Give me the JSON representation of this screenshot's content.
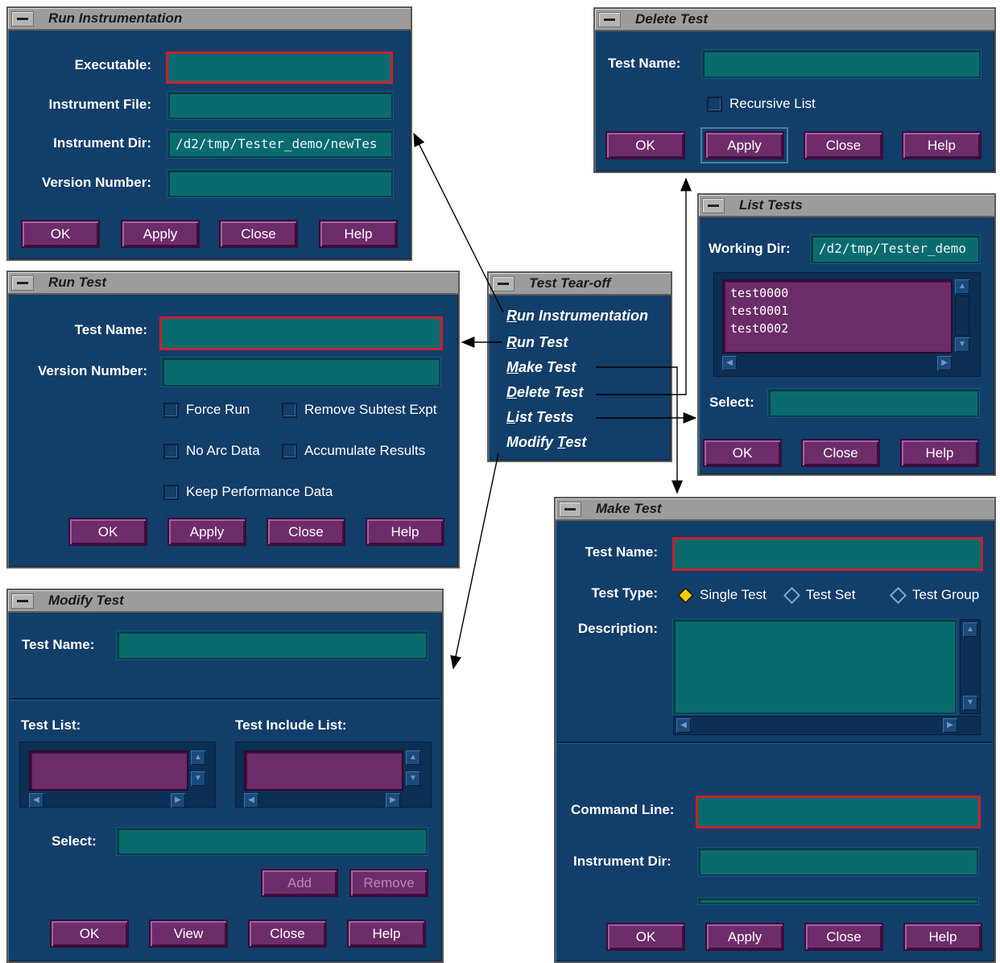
{
  "common": {
    "ok": "OK",
    "apply": "Apply",
    "close": "Close",
    "help": "Help",
    "view": "View",
    "add": "Add",
    "remove": "Remove"
  },
  "run_instrumentation": {
    "title": "Run Instrumentation",
    "executable_label": "Executable:",
    "executable_value": "",
    "instrument_file_label": "Instrument File:",
    "instrument_dir_label": "Instrument Dir:",
    "instrument_dir_value": "/d2/tmp/Tester_demo/newTes",
    "version_label": "Version Number:"
  },
  "run_test": {
    "title": "Run Test",
    "test_name_label": "Test Name:",
    "version_label": "Version Number:",
    "force_run": "Force Run",
    "remove_subtest": "Remove Subtest Expt",
    "no_arc": "No Arc Data",
    "accumulate": "Accumulate Results",
    "keep_perf": "Keep Performance Data"
  },
  "modify_test": {
    "title": "Modify Test",
    "test_name_label": "Test Name:",
    "test_list_label": "Test List:",
    "test_include_label": "Test Include List:",
    "select_label": "Select:"
  },
  "tear_off": {
    "title": "Test Tear-off",
    "items": [
      {
        "pre": "",
        "u": "R",
        "post": "un Instrumentation",
        "full": "Run Instrumentation"
      },
      {
        "pre": "",
        "u": "R",
        "post": "un Test",
        "full": "Run Test"
      },
      {
        "pre": "",
        "u": "M",
        "post": "ake Test",
        "full": "Make Test"
      },
      {
        "pre": "",
        "u": "D",
        "post": "elete Test",
        "full": "Delete Test"
      },
      {
        "pre": "",
        "u": "L",
        "post": "ist Tests",
        "full": "List Tests"
      },
      {
        "pre": "Modify ",
        "u": "T",
        "post": "est",
        "full": "Modify Test"
      }
    ]
  },
  "delete_test": {
    "title": "Delete Test",
    "test_name_label": "Test Name:",
    "recursive": "Recursive List"
  },
  "list_tests": {
    "title": "List Tests",
    "working_dir_label": "Working Dir:",
    "working_dir_value": "/d2/tmp/Tester_demo",
    "items": [
      "test0000",
      "test0001",
      "test0002"
    ],
    "select_label": "Select:"
  },
  "make_test": {
    "title": "Make Test",
    "test_name_label": "Test Name:",
    "test_type_label": "Test Type:",
    "types": [
      "Single Test",
      "Test Set",
      "Test Group"
    ],
    "selected_type": "Single Test",
    "description_label": "Description:",
    "command_line_label": "Command Line:",
    "instrument_dir_label": "Instrument Dir:"
  }
}
